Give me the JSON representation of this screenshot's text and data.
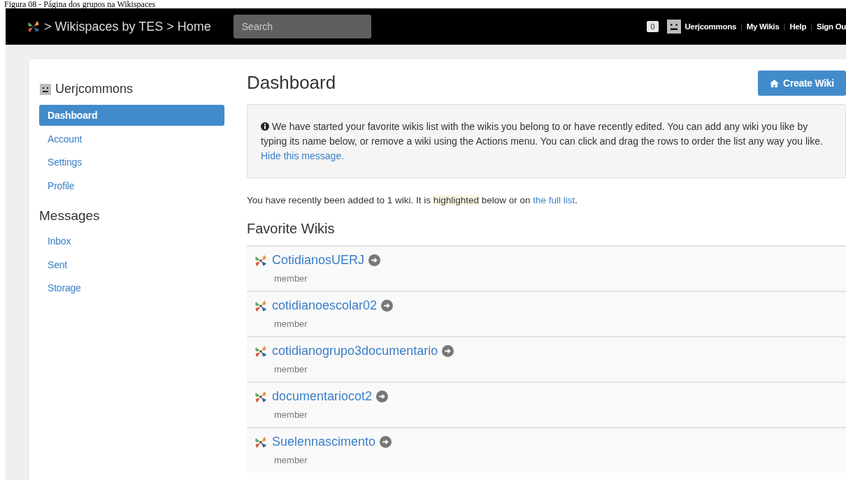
{
  "caption": "Figura 08 - Página dos grupos na Wikispaces",
  "topbar": {
    "breadcrumb": [
      {
        "sep": ">",
        "label": "Wikispaces by TES"
      },
      {
        "sep": ">",
        "label": "Home"
      }
    ],
    "search": {
      "placeholder": "Search"
    },
    "badge": "0",
    "separator": "|",
    "links": [
      "Uerjcommons",
      "My Wikis",
      "Help",
      "Sign Ou"
    ]
  },
  "sidebar": {
    "user": "Uerjcommons",
    "items": [
      {
        "label": "Dashboard",
        "selected": true
      },
      {
        "label": "Account",
        "selected": false
      },
      {
        "label": "Settings",
        "selected": false
      },
      {
        "label": "Profile",
        "selected": false
      }
    ],
    "messages": {
      "title": "Messages",
      "items": [
        {
          "label": "Inbox",
          "selected": false
        },
        {
          "label": "Sent",
          "selected": false
        },
        {
          "label": "Storage",
          "selected": false
        }
      ]
    }
  },
  "main": {
    "title": "Dashboard",
    "create_button": "Create Wiki",
    "info": {
      "text": "We have started your favorite wikis list with the wikis you belong to or have recently edited. You can add any wiki you like by typing its name below, or remove a wiki using the Actions menu. You can click and drag the rows to order the list any way you like. ",
      "link": "Hide this message."
    },
    "notice": {
      "before": "You have recently been added to 1 wiki. It is ",
      "highlight": "highlighted",
      "middle": " below or on ",
      "link": "the full list",
      "after": "."
    },
    "favorites_title": "Favorite Wikis",
    "wikis": [
      {
        "name": "CotidianosUERJ",
        "role": "member"
      },
      {
        "name": "cotidianoescolar02",
        "role": "member"
      },
      {
        "name": "cotidianogrupo3documentario",
        "role": "member"
      },
      {
        "name": "documentariocot2",
        "role": "member"
      },
      {
        "name": "Suelennascimento",
        "role": "member"
      }
    ]
  }
}
